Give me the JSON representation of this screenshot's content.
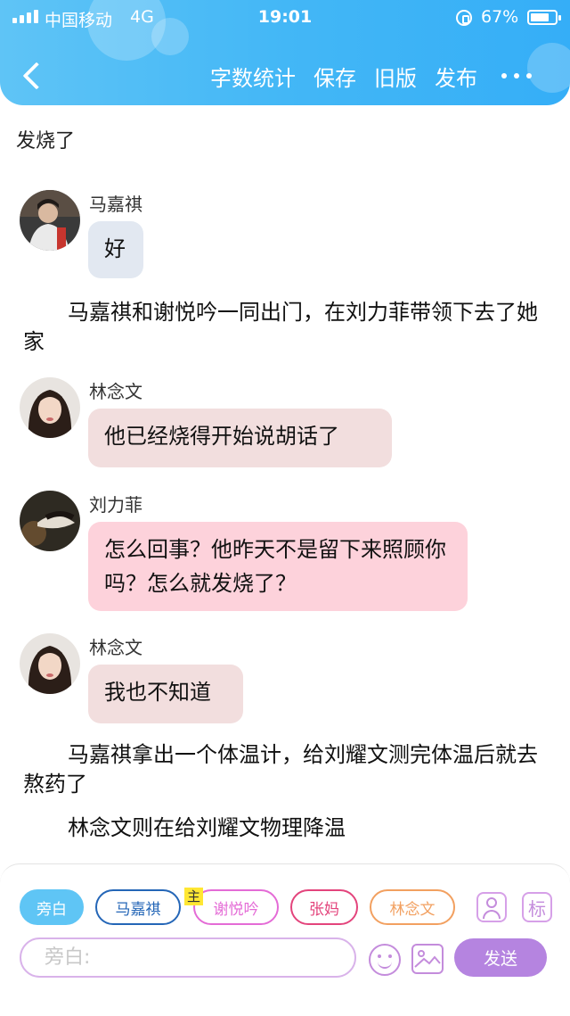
{
  "status_bar": {
    "carrier": "中国移动",
    "network": "4G",
    "time": "19:01",
    "battery": "67%"
  },
  "header": {
    "actions": [
      "字数统计",
      "保存",
      "旧版",
      "发布"
    ]
  },
  "content": {
    "title": "发烧了",
    "messages": [
      {
        "name": "马嘉祺",
        "text": "好"
      },
      {
        "name": "林念文",
        "text": "他已经烧得开始说胡话了"
      },
      {
        "name": "刘力菲",
        "text": "怎么回事？他昨天不是留下来照顾你吗？怎么就发烧了？"
      },
      {
        "name": "林念文",
        "text": "我也不知道"
      }
    ],
    "narrations": [
      "马嘉祺和谢悦吟一同出门，在刘力菲带领下去了她家",
      "马嘉祺拿出一个体温计，给刘耀文测完体温后就去熬药了",
      "林念文则在给刘耀文物理降温"
    ]
  },
  "composer": {
    "chips": [
      "旁白",
      "马嘉祺",
      "谢悦吟",
      "张妈",
      "林念文"
    ],
    "master_tag": "主",
    "tag_button": "标",
    "input_placeholder": "旁白:",
    "send_label": "发送"
  },
  "colors": {
    "header": "#43b7f6",
    "bubble_ma": "#e2e8f1",
    "bubble_lin": "#f2dede",
    "bubble_liu": "#fdd2db",
    "accent": "#b584e0"
  }
}
